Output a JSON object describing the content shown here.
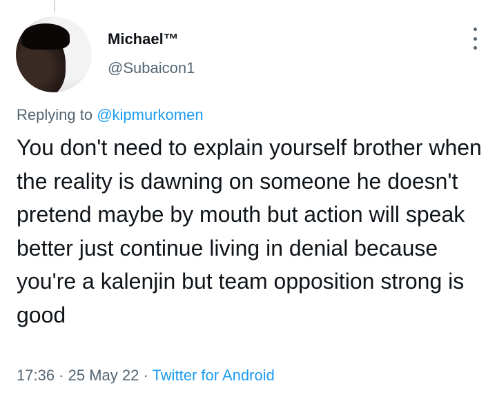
{
  "user": {
    "display_name": "Michael™",
    "handle": "@Subaicon1"
  },
  "reply": {
    "prefix": "Replying to ",
    "mention": "@kipmurkomen"
  },
  "tweet": {
    "text": "You don't need to explain yourself brother when the reality is dawning on someone he doesn't pretend maybe by mouth but action will speak better just continue living in denial because you're a kalenjin but team opposition strong is good"
  },
  "meta": {
    "time": "17:36",
    "separator1": " · ",
    "date": "25 May 22",
    "separator2": " · ",
    "source": "Twitter for Android"
  },
  "icons": {
    "more": "more-vertical-icon"
  },
  "colors": {
    "link": "#1d9bf0",
    "secondary_text": "#536471",
    "primary_text": "#0f1419",
    "thread_line": "#cfd9de"
  }
}
